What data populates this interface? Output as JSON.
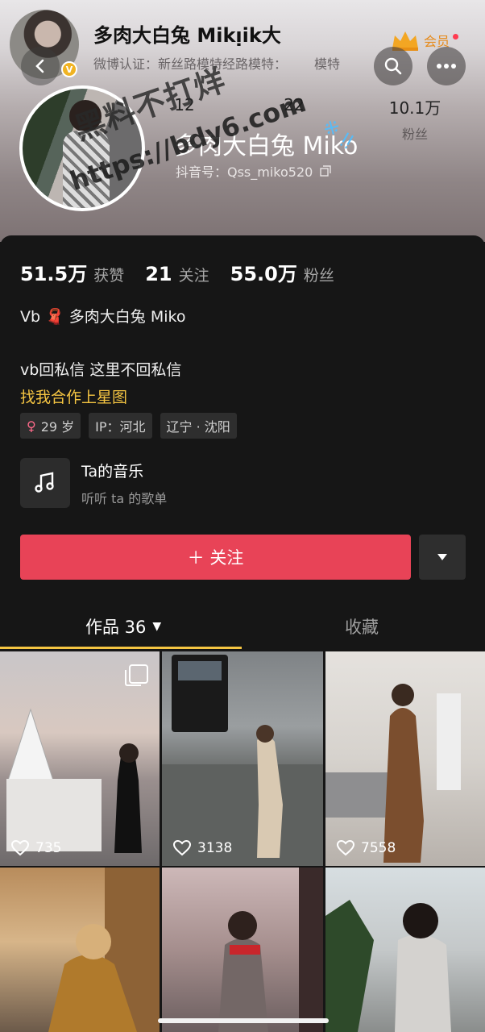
{
  "header": {
    "name": "多肉大白兔 Mikᴉik大",
    "certification": "微博认证：新丝路模特经路模特：",
    "certification_tail": "模特",
    "vip_label": "会员",
    "stats": [
      {
        "number": "12",
        "label": ""
      },
      {
        "number": "22",
        "label": ""
      },
      {
        "number": "10.1万",
        "label": "粉丝"
      }
    ],
    "profile_name": "多肉大白兔 Miko",
    "profile_id": "抖音号：Qss_miko520",
    "watermark_line1": "黑料不打烊",
    "watermark_line2": "https://bdy6.com",
    "watermark_line3": "※ ᴉᴉ"
  },
  "profile": {
    "likes_count": "51.5万",
    "likes_label": "获赞",
    "following_count": "21",
    "following_label": "关注",
    "followers_count": "55.0万",
    "followers_label": "粉丝",
    "bio_line1": "Vb 🧣 多肉大白兔 Miko",
    "bio_line2": "vb回私信  这里不回私信",
    "bio_line3": "找我合作上星图",
    "tags": [
      "29 岁",
      "IP：河北",
      "辽宁 · 沈阳"
    ],
    "music_title": "Ta的音乐",
    "music_subtitle": "听听 ta 的歌单",
    "follow_label": "＋ 关注"
  },
  "tabs": {
    "works_label": "作品 36",
    "favorites_label": "收藏"
  },
  "posts": [
    {
      "likes": "735",
      "scene": "church"
    },
    {
      "likes": "3138",
      "scene": "beach"
    },
    {
      "likes": "7558",
      "scene": "room"
    },
    {
      "likes": "",
      "scene": "sofa"
    },
    {
      "likes": "",
      "scene": "mirror"
    },
    {
      "likes": "",
      "scene": "plants"
    }
  ],
  "colors": {
    "accent_follow": "#e84357",
    "highlight_text": "#f5c542",
    "vip": "#e68a1a"
  }
}
